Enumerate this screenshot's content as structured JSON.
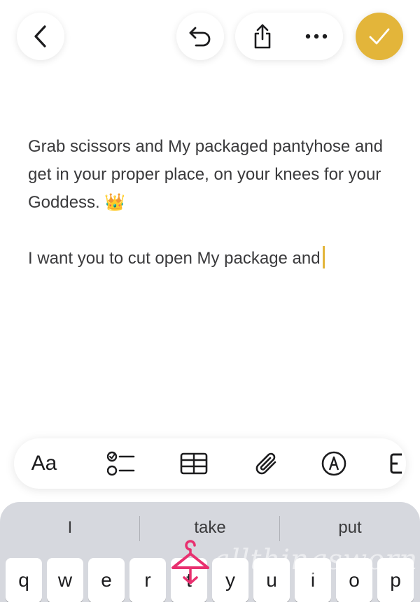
{
  "note": {
    "paragraph1": "Grab scissors and My packaged pantyhose and get in your proper place, on your knees for your Goddess. 👑",
    "paragraph2": "I want you to cut open My package and"
  },
  "format_bar": {
    "text_style_label": "Aa"
  },
  "keyboard": {
    "suggestions": [
      "I",
      "take",
      "put"
    ],
    "keys": [
      "q",
      "w",
      "e",
      "r",
      "t",
      "y",
      "u",
      "i",
      "o",
      "p"
    ]
  },
  "watermark": {
    "text": "allthingsworn"
  },
  "colors": {
    "accent": "#e3b53a",
    "keyboard_bg": "#d6d8de",
    "watermark_pink": "#e8306f"
  }
}
